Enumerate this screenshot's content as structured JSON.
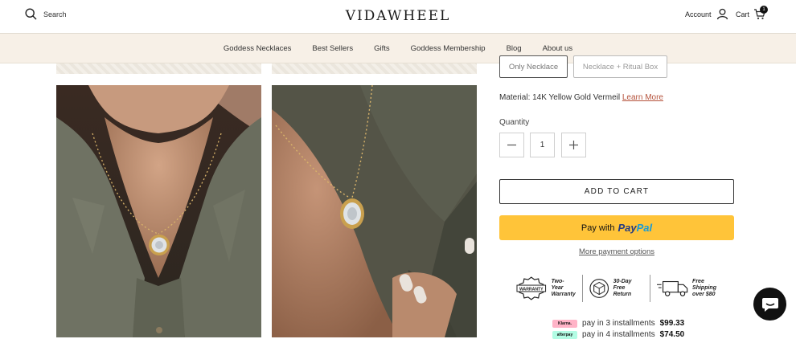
{
  "header": {
    "search_label": "Search",
    "logo": "VIDAWHEEL",
    "account_label": "Account",
    "cart_label": "Cart",
    "cart_count": "1"
  },
  "nav": {
    "items": [
      "Goddess Necklaces",
      "Best Sellers",
      "Gifts",
      "Goddess Membership",
      "Blog",
      "About us"
    ]
  },
  "product": {
    "variants": [
      "Only Necklace",
      "Necklace + Ritual Box"
    ],
    "material_label": "Material: 14K Yellow Gold Vermeil",
    "learn_more": "Learn More",
    "quantity_label": "Quantity",
    "quantity_value": "1",
    "add_to_cart": "ADD TO CART",
    "paypal_prefix": "Pay with",
    "paypal_brand_1": "Pay",
    "paypal_brand_2": "Pal",
    "more_payment": "More payment options"
  },
  "badges": [
    {
      "icon": "warranty-icon",
      "stamp": "WARRANTY",
      "text_1": "Two-Year",
      "text_2": "Warranty"
    },
    {
      "icon": "return-box-icon",
      "text_1": "30-Day",
      "text_2": "Free Return"
    },
    {
      "icon": "delivery-truck-icon",
      "text_1": "Free Shipping",
      "text_2": "over $80"
    }
  ],
  "installments": [
    {
      "provider": "Klarna.",
      "text": "pay in 3 installments",
      "amount": "$99.33",
      "color": "#ffb3c7"
    },
    {
      "provider": "afterpay",
      "text": "pay in 4 installments",
      "amount": "$74.50",
      "color": "#b2fce4"
    }
  ],
  "colors": {
    "nav_bg": "#f7f0e7",
    "paypal_yellow": "#ffc439",
    "link_red": "#b5523b",
    "chat_bg": "#111111"
  }
}
